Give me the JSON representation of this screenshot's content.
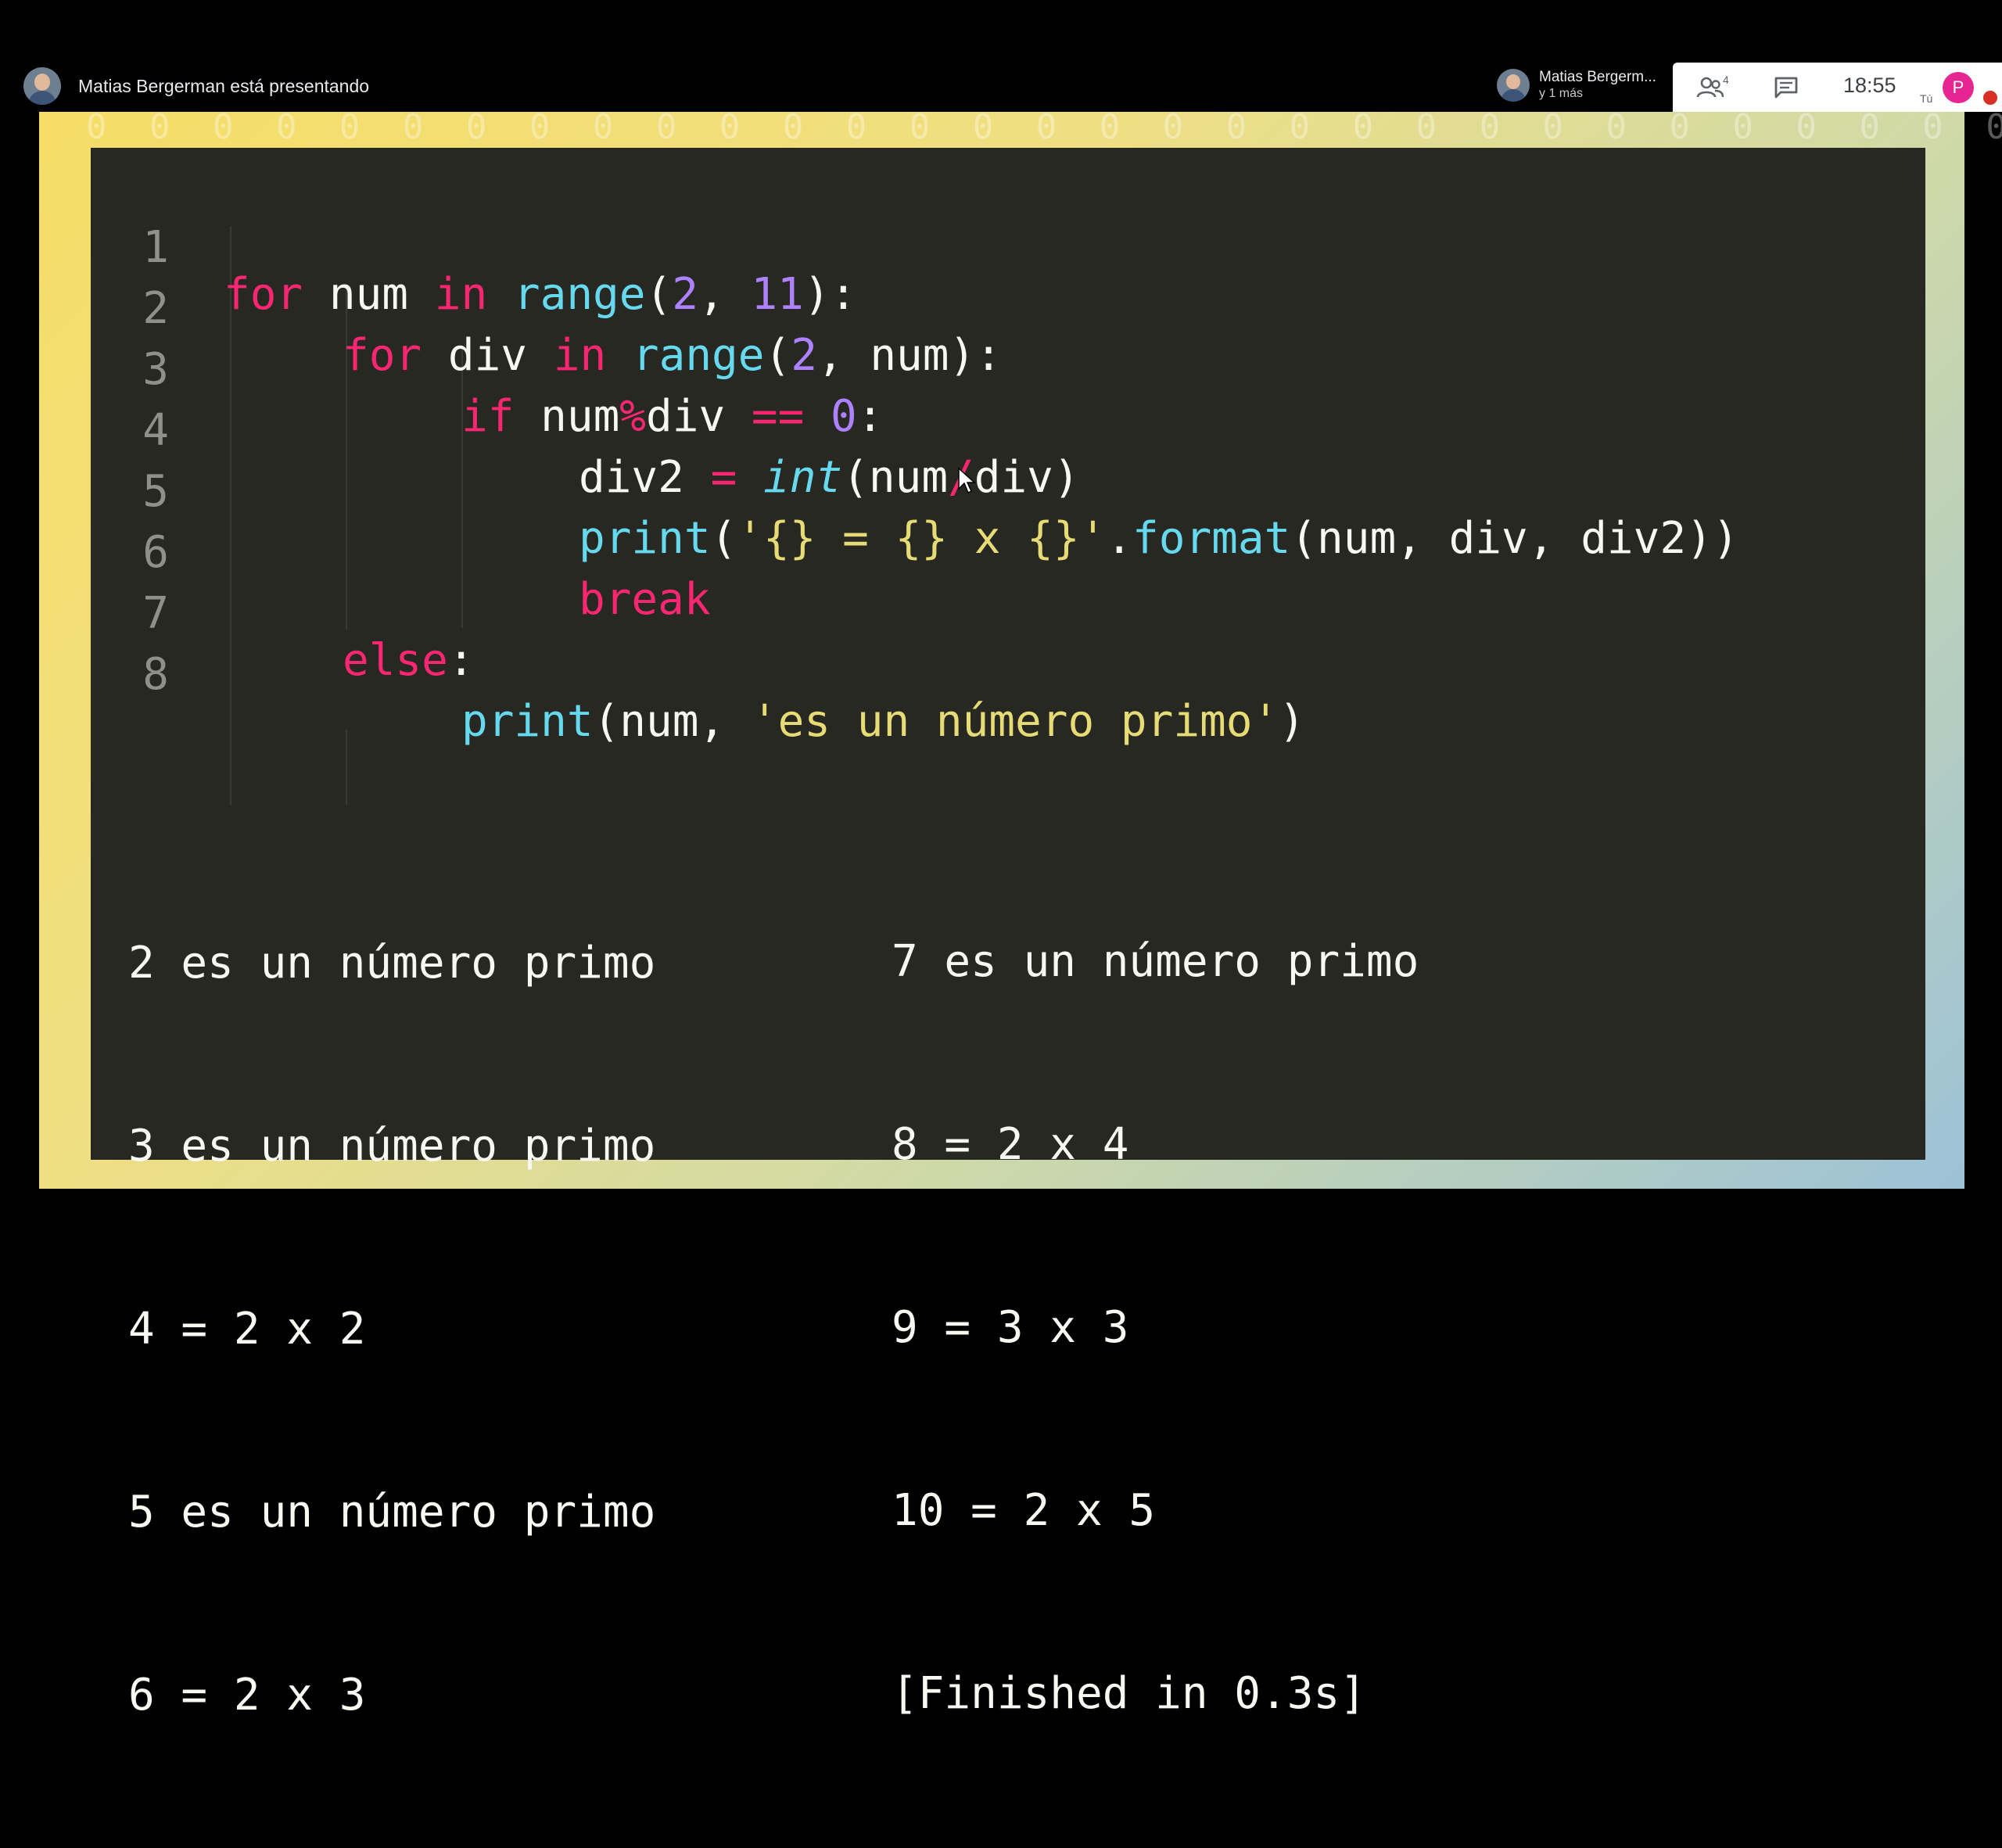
{
  "meeting": {
    "presenting_text": "Matias Bergerman está presentando",
    "participant_name": "Matias Bergerm...",
    "participant_more": "y 1 más",
    "people_count": "4",
    "time": "18:55",
    "self_label": "Tú",
    "self_initial": "P"
  },
  "slide": {
    "background_zeros": "0 0 0 0 0 0 0 0 0 0 0 0 0 0 0 0 0 0 0 0 0 0 0 0 0 0 0 0 0 0 0 0 0 0 0 0",
    "line_numbers": [
      "1",
      "2",
      "3",
      "4",
      "5",
      "6",
      "7",
      "8"
    ],
    "code": {
      "l1": {
        "kw_for": "for",
        "t1": " num ",
        "kw_in": "in",
        "sp": " ",
        "fn_range": "range",
        "p1": "(",
        "n2": "2",
        "c": ", ",
        "n11": "11",
        "p2": "):"
      },
      "l2": {
        "kw_for": "for",
        "t1": " div ",
        "kw_in": "in",
        "sp": " ",
        "fn_range": "range",
        "p1": "(",
        "n2": "2",
        "t2": ", num):"
      },
      "l3": {
        "kw_if": "if",
        "t1": " num",
        "op_mod": "%",
        "t2": "div ",
        "op_eq": "==",
        "sp": " ",
        "n0": "0",
        "colon": ":"
      },
      "l4": {
        "t1": "div2 ",
        "op_assign": "=",
        "sp": " ",
        "fn_int": "int",
        "t2": "(num",
        "op_div": "/",
        "t3": "div)"
      },
      "l5": {
        "fn_print": "print",
        "p1": "(",
        "str": "'{} = {} x {}'",
        "dot": ".",
        "fn_format": "format",
        "t2": "(num, div, div2))"
      },
      "l6": {
        "kw_break": "break"
      },
      "l7": {
        "kw_else": "else",
        "colon": ":"
      },
      "l8": {
        "fn_print": "print",
        "t1": "(num, ",
        "str": "'es un número primo'",
        "t2": ")"
      }
    },
    "output_left": [
      "2 es un número primo",
      "3 es un número primo",
      "4 = 2 x 2",
      "5 es un número primo",
      "6 = 2 x 3"
    ],
    "output_right": [
      "7 es un número primo",
      "8 = 2 x 4",
      "9 = 3 x 3",
      "10 = 2 x 5",
      "[Finished in 0.3s]"
    ]
  },
  "colors": {
    "keyword": "#f92672",
    "function": "#66d9ef",
    "number": "#ae81ff",
    "string": "#e6db74",
    "editor_bg": "#272822",
    "avatar_accent": "#e52592"
  }
}
